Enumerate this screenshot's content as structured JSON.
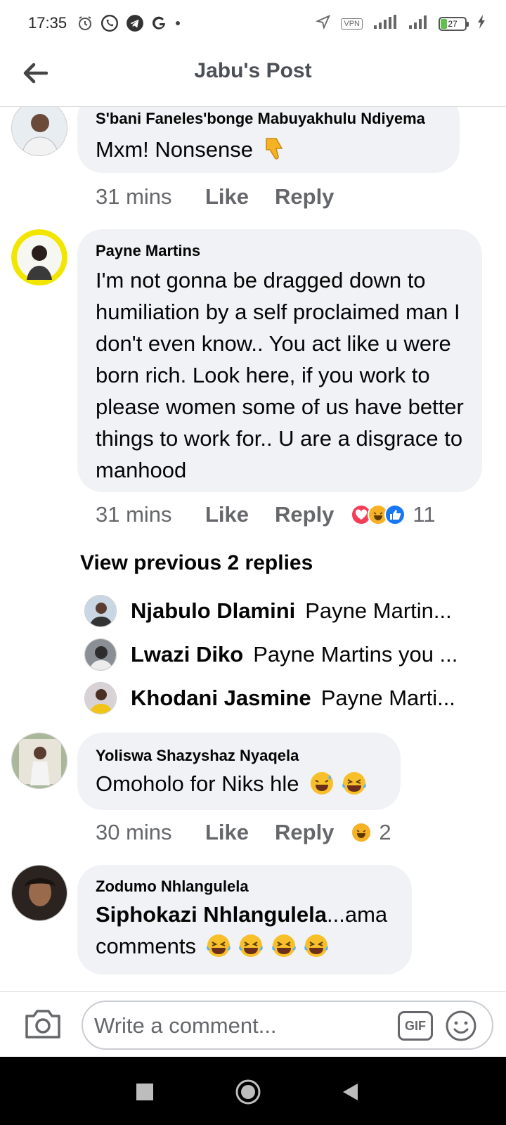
{
  "status_bar": {
    "time": "17:35",
    "vpn_label": "VPN",
    "battery_level": "27",
    "battery_fraction": 0.27,
    "icons": [
      "alarm-icon",
      "whatsapp-icon",
      "telegram-icon",
      "google-icon",
      "dot-icon",
      "location-icon",
      "vpn-icon",
      "signal-icon",
      "signal-icon",
      "battery-icon",
      "charging-icon"
    ]
  },
  "header": {
    "title": "Jabu's Post",
    "back_icon": "back-arrow-icon"
  },
  "comments": [
    {
      "author": "S'bani Faneles'bonge Mabuyakhulu Ndiyema",
      "text": "Mxm! Nonsense",
      "emoji": "thumbs-down",
      "time": "31 mins",
      "like_label": "Like",
      "reply_label": "Reply"
    },
    {
      "author": "Payne Martins",
      "text": "I'm not gonna be dragged down to humiliation by a self proclaimed man I don't even know.. You act like u were born rich. Look here, if you work to please women some of us have better things to work for.. U are a disgrace to manhood",
      "time": "31 mins",
      "like_label": "Like",
      "reply_label": "Reply",
      "reactions": [
        "love",
        "haha",
        "like"
      ],
      "reaction_count": "11"
    },
    {
      "author": "Yoliswa Shazyshaz Nyaqela",
      "text": "Omoholo for Niks hle",
      "emoji": "sweat-smile laughing",
      "time": "30 mins",
      "like_label": "Like",
      "reply_label": "Reply",
      "reactions": [
        "haha"
      ],
      "reaction_count": "2"
    },
    {
      "author": "Zodumo Nhlangulela",
      "mention": "Siphokazi Nhlangulela",
      "text": "...ama comments",
      "emoji": "laughing x4"
    }
  ],
  "replies_section": {
    "view_previous_label": "View previous 2 replies",
    "replies": [
      {
        "author": "Njabulo Dlamini",
        "preview": "Payne Martin..."
      },
      {
        "author": "Lwazi Diko",
        "preview": "Payne Martins you ..."
      },
      {
        "author": "Khodani Jasmine",
        "preview": "Payne Marti..."
      }
    ]
  },
  "composer": {
    "placeholder": "Write a comment...",
    "gif_label": "GIF",
    "camera_icon": "camera-icon",
    "emoji_icon": "emoji-icon"
  },
  "colors": {
    "bubble": "#f0f2f5",
    "secondary_text": "#65676b",
    "love_red": "#f33e58",
    "like_blue": "#1877f2",
    "haha_yellow": "#f7b125"
  }
}
